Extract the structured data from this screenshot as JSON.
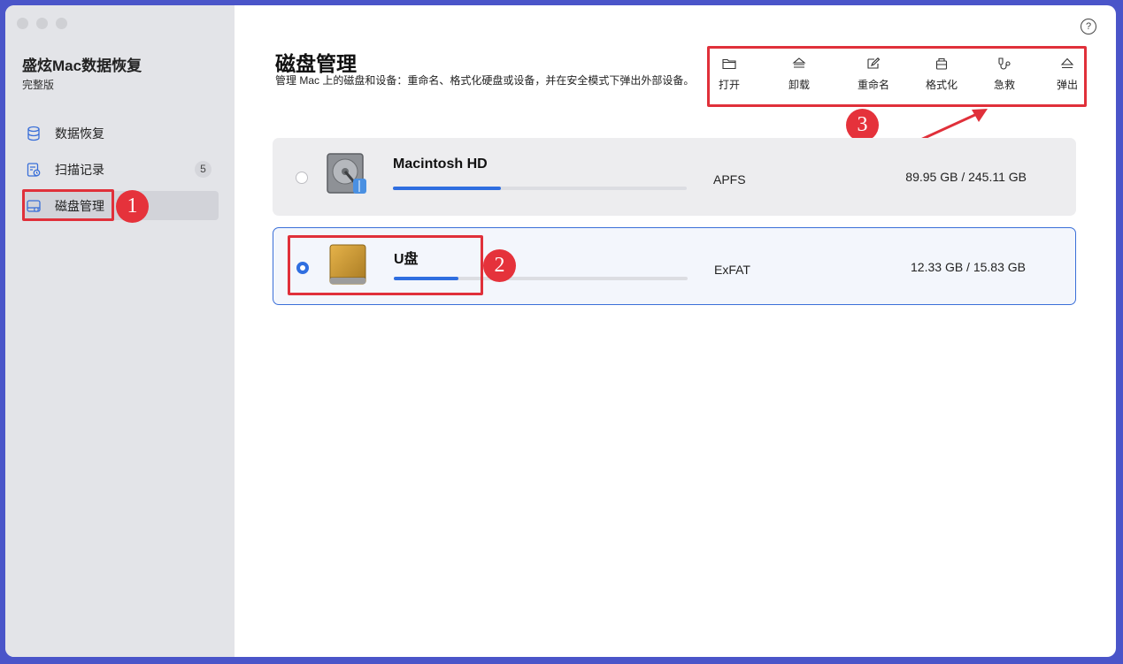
{
  "app": {
    "title": "盛炫Mac数据恢复",
    "edition": "完整版"
  },
  "sidebar": {
    "items": [
      {
        "label": "数据恢复",
        "icon": "database-icon"
      },
      {
        "label": "扫描记录",
        "icon": "scan-history-icon",
        "badge": "5"
      },
      {
        "label": "磁盘管理",
        "icon": "disk-manage-icon"
      }
    ]
  },
  "header": {
    "title": "磁盘管理",
    "description": "管理 Mac 上的磁盘和设备：重命名、格式化硬盘或设备，并在安全模式下弹出外部设备。",
    "help": "?"
  },
  "toolbar": {
    "items": [
      {
        "label": "打开",
        "icon": "folder-open-icon"
      },
      {
        "label": "卸载",
        "icon": "unmount-icon"
      },
      {
        "label": "重命名",
        "icon": "rename-icon"
      },
      {
        "label": "格式化",
        "icon": "format-icon"
      },
      {
        "label": "急救",
        "icon": "first-aid-icon"
      },
      {
        "label": "弹出",
        "icon": "eject-icon"
      }
    ]
  },
  "disks": [
    {
      "name": "Macintosh HD",
      "filesystem": "APFS",
      "capacity": "89.95 GB / 245.11 GB",
      "usage_fraction": 0.367,
      "selected": false
    },
    {
      "name": "U盘",
      "filesystem": "ExFAT",
      "capacity": "12.33 GB / 15.83 GB",
      "usage_fraction": 0.22,
      "selected": true
    }
  ],
  "annotations": [
    "1",
    "2",
    "3"
  ],
  "colors": {
    "accent": "#2f6ee0",
    "annotation_red": "#e0303a",
    "sidebar_bg": "#e3e4e8",
    "frame": "#4a55c9"
  }
}
